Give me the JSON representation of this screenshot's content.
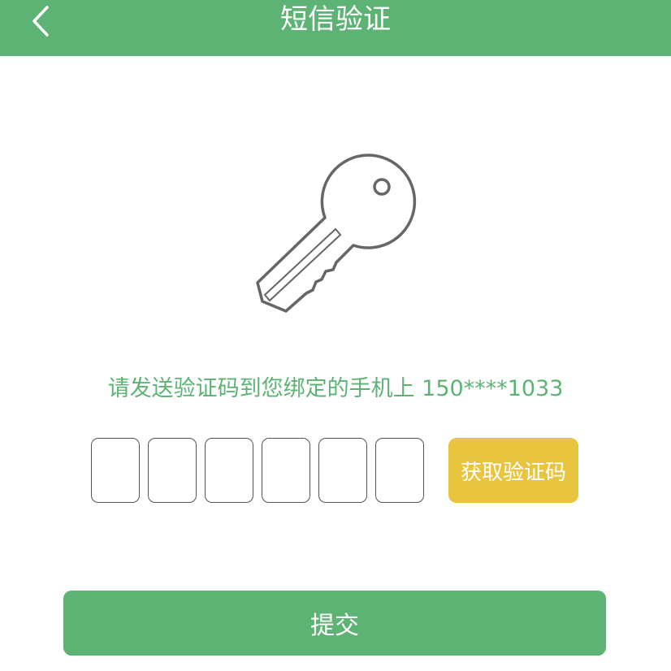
{
  "header": {
    "title": "短信验证",
    "back_icon": "chevron-left-icon"
  },
  "illustration": {
    "icon": "key-icon"
  },
  "verification": {
    "hint": "请发送验证码到您绑定的手机上 150****1033",
    "code_length": 6,
    "code_values": [
      "",
      "",
      "",
      "",
      "",
      ""
    ],
    "get_code_label": "获取验证码"
  },
  "actions": {
    "submit_label": "提交"
  },
  "colors": {
    "primary": "#5db374",
    "accent": "#e8c43f",
    "box_border": "#555555"
  }
}
